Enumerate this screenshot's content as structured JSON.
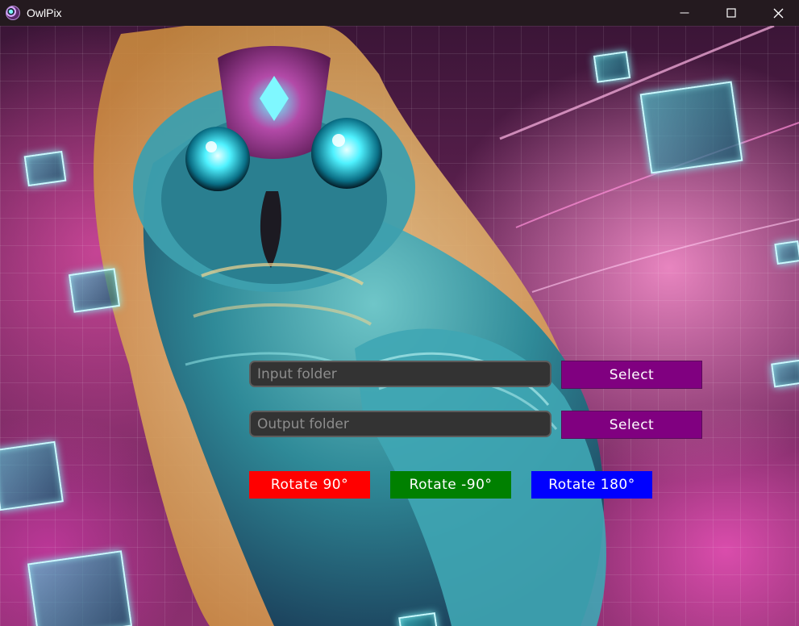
{
  "window": {
    "title": "OwlPix",
    "icon": "owl-app-icon",
    "controls": [
      "minimize-icon",
      "maximize-icon",
      "close-icon"
    ]
  },
  "form": {
    "input_folder": {
      "value": "",
      "placeholder": "Input folder"
    },
    "output_folder": {
      "value": "",
      "placeholder": "Output folder"
    },
    "select_input_label": "Select",
    "select_output_label": "Select"
  },
  "rotate_buttons": [
    {
      "label": "Rotate 90°",
      "color": "#ff0000"
    },
    {
      "label": "Rotate -90°",
      "color": "#008000"
    },
    {
      "label": "Rotate 180°",
      "color": "#0000ff"
    }
  ],
  "colors": {
    "titlebar": "#241a1f",
    "select_button": "#800080",
    "field_background": "#333333"
  },
  "background": "owl-illustration"
}
